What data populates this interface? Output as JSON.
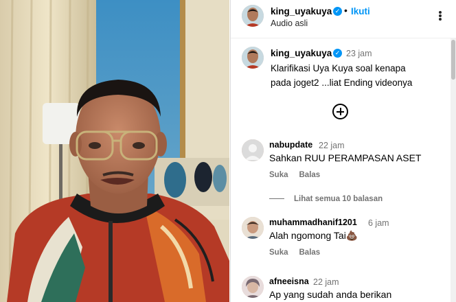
{
  "header": {
    "username": "king_uyakuya",
    "separator": "•",
    "follow_label": "Ikuti",
    "audio_label": "Audio asli"
  },
  "caption": {
    "username": "king_uyakuya",
    "time": "23 jam",
    "text": "Klarifikasi Uya Kuya soal kenapa pada joget2 ...liat Ending videonya"
  },
  "comments": [
    {
      "username": "nabupdate",
      "time": "22 jam",
      "text": "Sahkan RUU PERAMPASAN ASET",
      "like_label": "Suka",
      "reply_label": "Balas"
    },
    {
      "username": "muhammadhanif1201",
      "time": "6 jam",
      "text": "Alah ngomong Tai💩",
      "like_label": "Suka",
      "reply_label": "Balas"
    },
    {
      "username": "afneeisna",
      "time": "22 jam",
      "text": "Ap yang sudah anda berikan"
    }
  ],
  "view_replies_label": "Lihat semua 10 balasan",
  "icons": {
    "verified": "verified-badge-icon",
    "more": "more-options-icon",
    "load_more": "plus-circle-icon"
  },
  "colors": {
    "link": "#0095f6",
    "muted": "#737373",
    "verified": "#0095f6"
  }
}
